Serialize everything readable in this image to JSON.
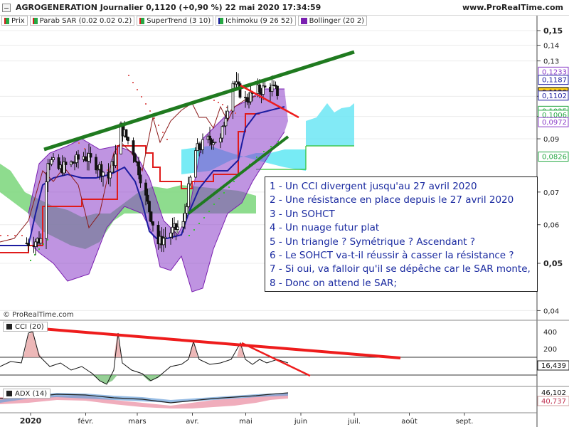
{
  "header": {
    "title": "AGROGENERATION Journalier 0,1120 (+0,90 %) 22 mai 2020 17:34:59",
    "site": "www.ProRealTime.com"
  },
  "legend": [
    {
      "label": "Prix",
      "color": "#27a844"
    },
    {
      "label": "Parab SAR (0.02 0.02 0.2)",
      "color": "#27a844"
    },
    {
      "label": "SuperTrend (3 10)",
      "color": "#d81e1e"
    },
    {
      "label": "Ichimoku (9 26 52)",
      "color": "#27a844"
    },
    {
      "label": "Bollinger (20 2)",
      "color": "#7a1fb0"
    }
  ],
  "watermark": "© ProRealTime.com",
  "notes": [
    "1 - Un CCI divergent jusqu'au 27 avril 2020",
    "2 - Une résistance en place depuis le 27 avril  2020",
    "3 - Un SOHCT",
    "4 - Un nuage futur plat",
    "5 - Un triangle ? Symétrique ? Ascendant ?",
    "6 - Le SOHCT va-t-il réussir à casser la résistance ?",
    "7 - Si oui, va falloir qu'il se dépêche car le SAR monte,",
    "8 - Donc on attend le SAR;"
  ],
  "cci_legend": "CCI (20)",
  "adx_legend": "ADX (14)",
  "colors": {
    "bull_green": "#1f7a1f",
    "bear_red": "#ee1c1c",
    "bollinger": "#8a3cc8",
    "cloud_cyan": "#55e6f2",
    "cloud_green": "#7ad67a",
    "supertrend": "#e01b1b",
    "tenkan": "#1c1ca0"
  },
  "chart_data": [
    {
      "type": "candlestick",
      "title": "AGROGENERATION Journalier 0,1120 (+0,90 %) 22 mai 2020 17:34:59",
      "ylim": [
        0.035,
        0.155
      ],
      "y_scale": "log",
      "y_ticks": [
        "0,15",
        "0,14",
        "0,13",
        "0,11",
        "0,1",
        "0,09",
        "0,07",
        "0,06",
        "0,05",
        "0,04"
      ],
      "bold_ticks": [
        "0,15",
        "0,05"
      ],
      "x_ticks": [
        "2020",
        "févr.",
        "mars",
        "avr.",
        "mai",
        "juin",
        "juil.",
        "août",
        "sept."
      ],
      "price_tags": [
        {
          "value": "0,1233",
          "color": "#8a3cc8",
          "bg": "#ffffff"
        },
        {
          "value": "0,1187",
          "color": "#1c1ca0",
          "bg": "#ffffff"
        },
        {
          "value": "0,1120",
          "color": "#000000",
          "bg": "#ffd21a"
        },
        {
          "value": "0,1102",
          "color": "#1c1ca0",
          "bg": "#ffffff"
        },
        {
          "value": "0,1025",
          "color": "#27a844",
          "bg": "#ffffff"
        },
        {
          "value": "0,1006",
          "color": "#27a844",
          "bg": "#ffffff"
        },
        {
          "value": "0,0972",
          "color": "#8a3cc8",
          "bg": "#ffffff"
        },
        {
          "value": "0,0826",
          "color": "#27a844",
          "bg": "#ffffff"
        }
      ],
      "close_estimates": [
        {
          "date": "2020-01-02",
          "close": 0.055
        },
        {
          "date": "2020-01-10",
          "close": 0.056
        },
        {
          "date": "2020-01-14",
          "close": 0.082
        },
        {
          "date": "2020-01-20",
          "close": 0.078
        },
        {
          "date": "2020-01-27",
          "close": 0.08
        },
        {
          "date": "2020-02-03",
          "close": 0.083
        },
        {
          "date": "2020-02-10",
          "close": 0.08
        },
        {
          "date": "2020-02-17",
          "close": 0.075
        },
        {
          "date": "2020-02-21",
          "close": 0.083
        },
        {
          "date": "2020-02-24",
          "close": 0.095
        },
        {
          "date": "2020-03-02",
          "close": 0.085
        },
        {
          "date": "2020-03-09",
          "close": 0.068
        },
        {
          "date": "2020-03-16",
          "close": 0.055
        },
        {
          "date": "2020-03-23",
          "close": 0.058
        },
        {
          "date": "2020-03-30",
          "close": 0.06
        },
        {
          "date": "2020-04-06",
          "close": 0.085
        },
        {
          "date": "2020-04-14",
          "close": 0.09
        },
        {
          "date": "2020-04-20",
          "close": 0.089
        },
        {
          "date": "2020-04-27",
          "close": 0.118
        },
        {
          "date": "2020-05-04",
          "close": 0.108
        },
        {
          "date": "2020-05-11",
          "close": 0.113
        },
        {
          "date": "2020-05-18",
          "close": 0.115
        },
        {
          "date": "2020-05-22",
          "close": 0.112
        }
      ]
    },
    {
      "type": "line",
      "title": "CCI (20)",
      "y_ticks": [
        "400",
        "200"
      ],
      "last_value": "16,439"
    },
    {
      "type": "line",
      "title": "ADX (14)",
      "last_values": [
        "46,102",
        "40,737"
      ]
    }
  ]
}
